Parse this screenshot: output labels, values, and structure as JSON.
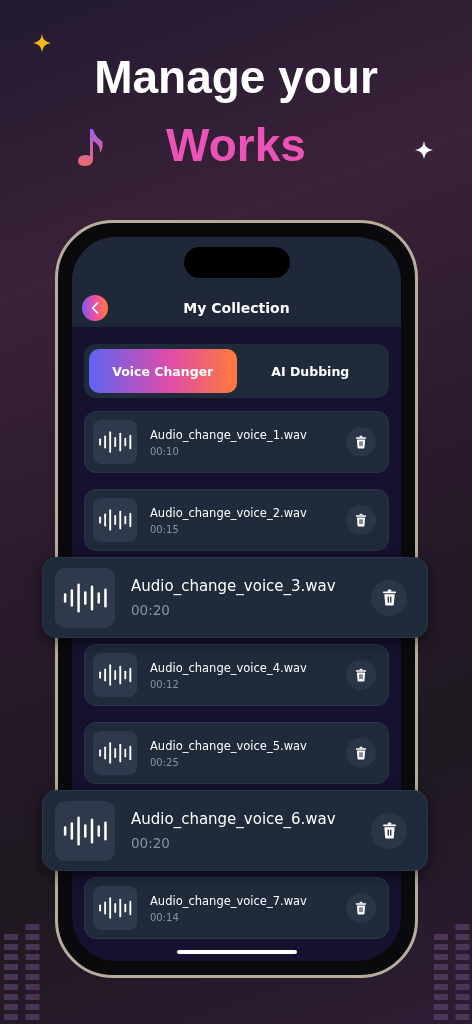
{
  "headline": {
    "line_1": "Manage your",
    "line_2": "Works"
  },
  "screen": {
    "title": "My Collection",
    "tabs": [
      {
        "label": "Voice Changer",
        "selected": true
      },
      {
        "label": "AI Dubbing",
        "selected": false
      }
    ],
    "recordings": [
      {
        "kind": "card",
        "name": "Audio_change_voice_1.wav",
        "duration": "00:10"
      },
      {
        "kind": "card",
        "name": "Audio_change_voice_2.wav",
        "duration": "00:15"
      },
      {
        "kind": "popout",
        "name": "Audio_change_voice_3.wav",
        "duration": "00:20"
      },
      {
        "kind": "card",
        "name": "Audio_change_voice_4.wav",
        "duration": "00:12"
      },
      {
        "kind": "card",
        "name": "Audio_change_voice_5.wav",
        "duration": "00:25"
      },
      {
        "kind": "popout",
        "name": "Audio_change_voice_6.wav",
        "duration": "00:20"
      },
      {
        "kind": "card",
        "name": "Audio_change_voice_7.wav",
        "duration": "00:14"
      }
    ]
  }
}
